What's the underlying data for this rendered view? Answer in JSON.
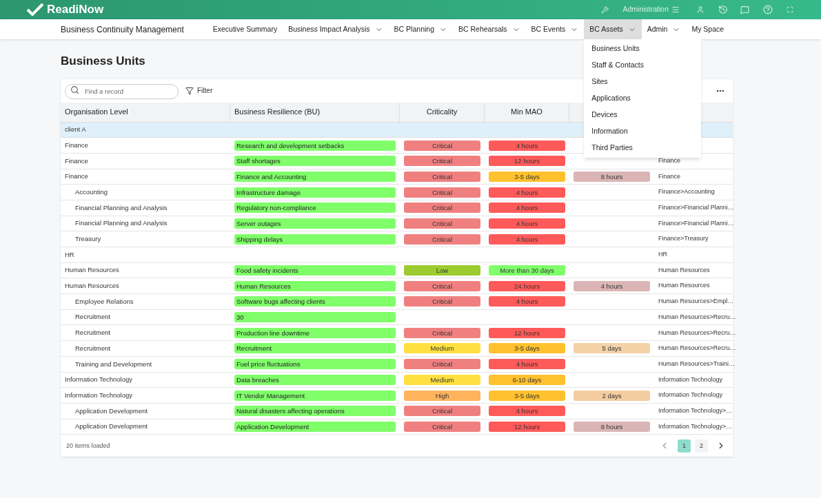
{
  "topbar": {
    "logo": "ReadiNow",
    "admin_label": "Administration"
  },
  "nav": {
    "title": "Business Continuity Management",
    "items": [
      {
        "label": "Executive Summary",
        "selected": false,
        "has_menu": false
      },
      {
        "label": "Business Impact Analysis",
        "selected": false,
        "has_menu": true
      },
      {
        "label": "BC Planning",
        "selected": false,
        "has_menu": true
      },
      {
        "label": "BC Rehearsals",
        "selected": false,
        "has_menu": true
      },
      {
        "label": "BC Events",
        "selected": false,
        "has_menu": true
      },
      {
        "label": "BC Assets",
        "selected": true,
        "has_menu": true,
        "menu_items": [
          "Business Units",
          "Staff & Contacts",
          "Sites",
          "Applications",
          "Devices",
          "Information",
          "Third Parties"
        ]
      },
      {
        "label": "Admin",
        "selected": false,
        "has_menu": true
      },
      {
        "label": "My Space",
        "selected": false,
        "has_menu": false
      }
    ]
  },
  "page_title": "Business Units",
  "search": {
    "placeholder": "Find a record"
  },
  "filter_label": "Filter",
  "table": {
    "columns": [
      "Organisation Level",
      "Business Resilience (BU)",
      "Criticality",
      "Min MAO"
    ],
    "rows": [
      {
        "kind": "group",
        "org": "client A"
      },
      {
        "kind": "row",
        "org": "Finance",
        "br": {
          "text": "Research and development setbacks",
          "color": "#80ff6a"
        },
        "criticality": {
          "text": "Critical",
          "color": "#f08080"
        },
        "mao": {
          "text": "4 hours",
          "color": "#ff5a5a"
        }
      },
      {
        "kind": "row",
        "org": "Finance",
        "br": {
          "text": "Staff shortages",
          "color": "#80ff6a"
        },
        "criticality": {
          "text": "Critical",
          "color": "#f08080"
        },
        "mao": {
          "text": "12 hours",
          "color": "#ff5a5a"
        },
        "column_6": "Finance"
      },
      {
        "kind": "row",
        "org": "Finance",
        "br": {
          "text": "Finance and Accounting",
          "color": "#80ff6a"
        },
        "criticality": {
          "text": "Critical",
          "color": "#f08080"
        },
        "mao": {
          "text": "3-5 days",
          "color": "#ffc12e"
        },
        "column_5": {
          "text": "8 hours",
          "color": "#dbb5b5"
        },
        "column_6": "Finance",
        "children": [
          {
            "kind": "row",
            "org": "Accounting",
            "br": {
              "text": "Infrastructure damage",
              "color": "#80ff6a"
            },
            "criticality": {
              "text": "Critical",
              "color": "#f08080"
            },
            "mao": {
              "text": "4 hours",
              "color": "#ff5a5a"
            },
            "column_6": "Finance>Accounting"
          },
          {
            "kind": "row",
            "org": "Financial Planning and Analysis",
            "br": {
              "text": "Regulatory non-compliance",
              "color": "#80ff6a"
            },
            "criticality": {
              "text": "Critical",
              "color": "#f08080"
            },
            "mao": {
              "text": "4 hours",
              "color": "#ff5a5a"
            },
            "column_6": "Finance>Financial Planni…"
          },
          {
            "kind": "row",
            "org": "Financial Planning and Analysis",
            "br": {
              "text": "Server outages",
              "color": "#80ff6a"
            },
            "criticality": {
              "text": "Critical",
              "color": "#f08080"
            },
            "mao": {
              "text": "4 hours",
              "color": "#ff5a5a"
            },
            "column_6": "Finance>Financial Planni…"
          },
          {
            "kind": "row",
            "org": "Treasury",
            "br": {
              "text": "Shipping delays",
              "color": "#80ff6a"
            },
            "criticality": {
              "text": "Critical",
              "color": "#f08080"
            },
            "mao": {
              "text": "4 hours",
              "color": "#ff5a5a"
            },
            "column_6": "Finance>Treasury"
          }
        ]
      },
      {
        "kind": "row",
        "org": "HR",
        "column_6": "HR"
      },
      {
        "kind": "row",
        "org": "Human Resources",
        "br": {
          "text": "Food safety incidents",
          "color": "#80ff6a"
        },
        "criticality": {
          "text": "Low",
          "color": "#9ccc30"
        },
        "mao": {
          "text": "More than 30 days",
          "color": "#80ff6a"
        },
        "column_6": "Human Resources"
      },
      {
        "kind": "row",
        "org": "Human Resources",
        "br": {
          "text": "Human Resources",
          "color": "#80ff6a"
        },
        "criticality": {
          "text": "Critical",
          "color": "#f08080"
        },
        "mao": {
          "text": "24 hours",
          "color": "#ff5a5a"
        },
        "column_5": {
          "text": "4 hours",
          "color": "#dbb5b5"
        },
        "column_6": "Human Resources",
        "children": [
          {
            "kind": "row",
            "org": "Employee Relations",
            "br": {
              "text": "Software bugs affecting clients",
              "color": "#80ff6a"
            },
            "criticality": {
              "text": "Critical",
              "color": "#f08080"
            },
            "mao": {
              "text": "4 hours",
              "color": "#ff5a5a"
            },
            "column_6": "Human Resources>Empl…"
          },
          {
            "kind": "row",
            "org": "Recruitment",
            "br": {
              "text": "30",
              "color": "#80ff6a"
            },
            "column_6": "Human Resources>Recru…"
          },
          {
            "kind": "row",
            "org": "Recruitment",
            "br": {
              "text": "Production line downtime",
              "color": "#80ff6a"
            },
            "criticality": {
              "text": "Critical",
              "color": "#f08080"
            },
            "mao": {
              "text": "12 hours",
              "color": "#ff5a5a"
            },
            "column_6": "Human Resources>Recru…"
          },
          {
            "kind": "row",
            "org": "Recruitment",
            "br": {
              "text": "Recruitment",
              "color": "#80ff6a"
            },
            "criticality": {
              "text": "Medium",
              "color": "#ffe040"
            },
            "mao": {
              "text": "3-5 days",
              "color": "#ffc12e"
            },
            "column_5": {
              "text": "5 days",
              "color": "#f3d2a8"
            },
            "column_6": "Human Resources>Recru…"
          },
          {
            "kind": "row",
            "org": "Training and Development",
            "br": {
              "text": "Fuel price fluctuations",
              "color": "#80ff6a"
            },
            "criticality": {
              "text": "Critical",
              "color": "#f08080"
            },
            "mao": {
              "text": "4 hours",
              "color": "#ff5a5a"
            },
            "column_6": "Human Resources>Traini…"
          }
        ]
      },
      {
        "kind": "row",
        "org": "Information Technology",
        "br": {
          "text": "Data breaches",
          "color": "#80ff6a"
        },
        "criticality": {
          "text": "Medium",
          "color": "#ffe040"
        },
        "mao": {
          "text": "6-10 days",
          "color": "#ffc12e"
        },
        "column_6": "Information Technology"
      },
      {
        "kind": "row",
        "org": "Information Technology",
        "br": {
          "text": "IT Vendor Management",
          "color": "#80ff6a"
        },
        "criticality": {
          "text": "High",
          "color": "#ffb35c"
        },
        "mao": {
          "text": "3-5 days",
          "color": "#ffc12e"
        },
        "column_5": {
          "text": "2 days",
          "color": "#f3cda0"
        },
        "column_6": "Information Technology",
        "children": [
          {
            "kind": "row",
            "org": "Application Development",
            "br": {
              "text": "Natural disasters affecting operations",
              "color": "#80ff6a"
            },
            "criticality": {
              "text": "Critical",
              "color": "#f08080"
            },
            "mao": {
              "text": "4 hours",
              "color": "#ff5a5a"
            },
            "column_6": "Information Technology>…"
          },
          {
            "kind": "row",
            "org": "Application Development",
            "br": {
              "text": "Application Development",
              "color": "#80ff6a"
            },
            "criticality": {
              "text": "Critical",
              "color": "#f08080"
            },
            "mao": {
              "text": "12 hours",
              "color": "#ff5a5a"
            },
            "column_5": {
              "text": "8 hours",
              "color": "#dbb5b5"
            },
            "column_6": "Information Technology>…"
          }
        ]
      }
    ]
  },
  "status": "20 items loaded",
  "pages": [
    {
      "label": "1",
      "selected": true
    },
    {
      "label": "2",
      "selected": false
    }
  ]
}
